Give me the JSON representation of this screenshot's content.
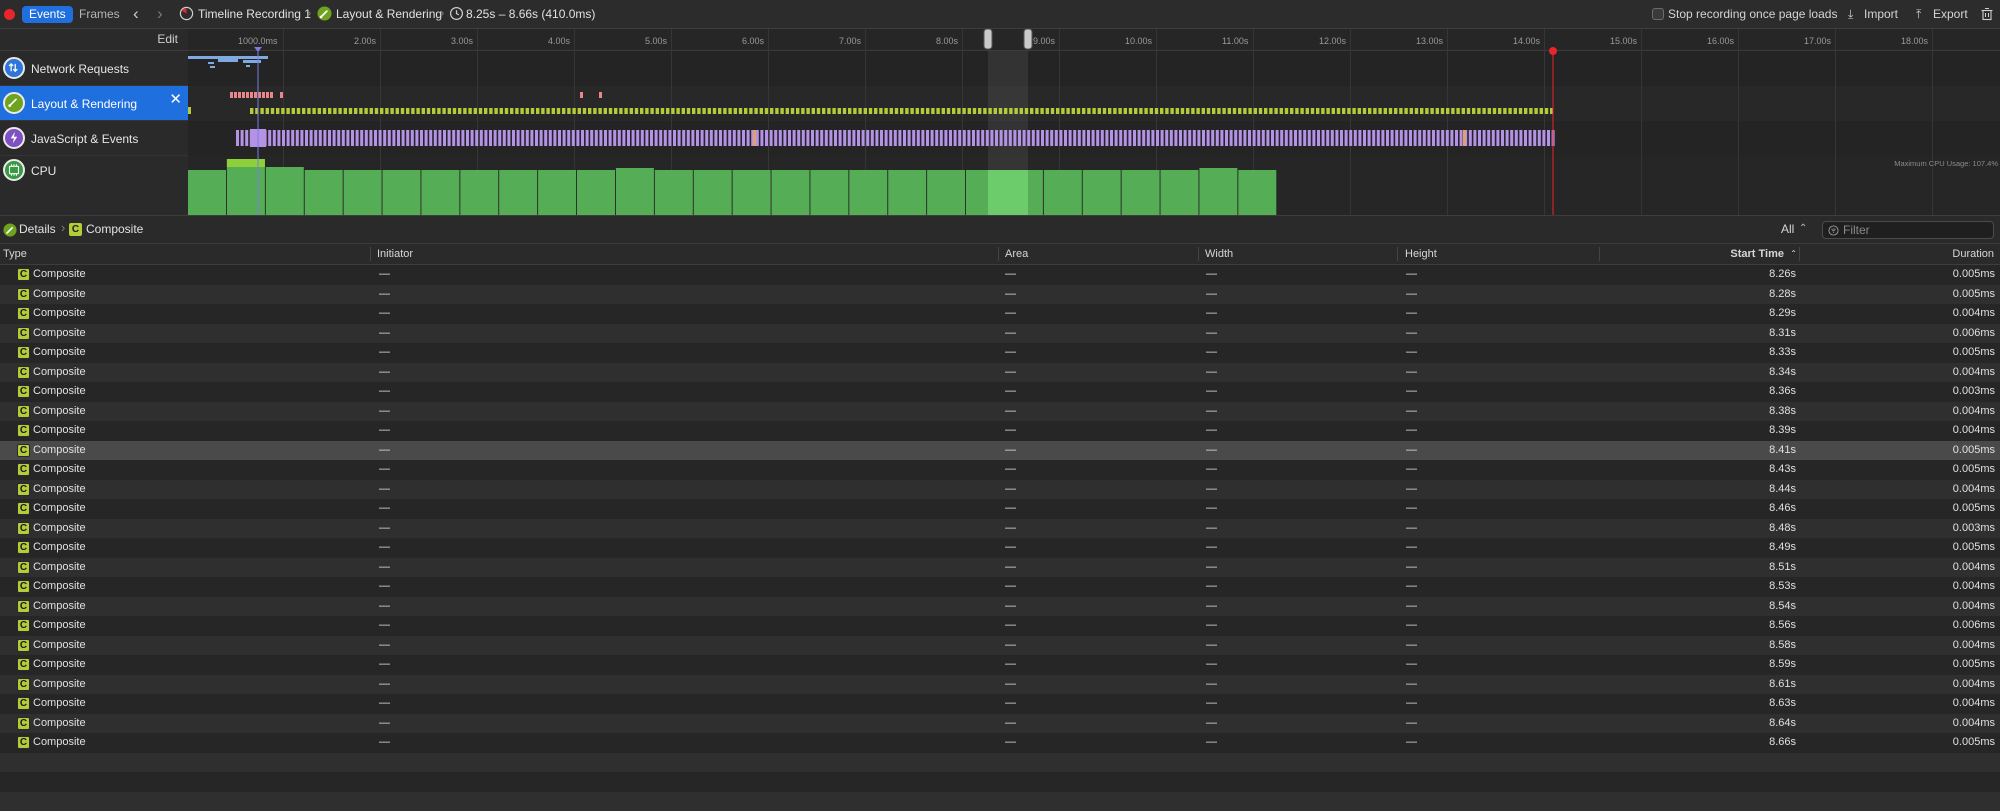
{
  "toolbar": {
    "tabs": [
      "Events",
      "Frames"
    ],
    "breadcrumb": [
      "Timeline Recording 1",
      "Layout & Rendering",
      "8.25s – 8.66s (410.0ms)"
    ],
    "stop_recording_label": "Stop recording once page loads",
    "import_label": "Import",
    "export_label": "Export",
    "colors": {
      "accent": "#1f6fde",
      "record": "#e8242c"
    }
  },
  "tracks": {
    "edit_label": "Edit",
    "ruler_ticks": [
      "1000.0ms",
      "2.00s",
      "3.00s",
      "4.00s",
      "5.00s",
      "6.00s",
      "7.00s",
      "8.00s",
      "9.00s",
      "10.00s",
      "11.00s",
      "12.00s",
      "13.00s",
      "14.00s",
      "15.00s",
      "16.00s",
      "17.00s",
      "18.00s"
    ],
    "items": [
      {
        "label": "Network Requests",
        "icon": "network-arrows-icon",
        "color": "#2f76d8"
      },
      {
        "label": "Layout & Rendering",
        "icon": "paintbrush-icon",
        "color": "#6fa31f"
      },
      {
        "label": "JavaScript & Events",
        "icon": "js-events-icon",
        "color": "#7f4fc4"
      },
      {
        "label": "CPU",
        "icon": "cpu-icon",
        "color": "#3a9a43"
      }
    ],
    "cpu_note": "Maximum CPU Usage: 107.4%",
    "colors": {
      "layout": "#b5cb3a",
      "js": "#b493e6",
      "cpu": "#55ad55",
      "paint": "#e9868a"
    }
  },
  "details": {
    "breadcrumb": [
      "Details",
      "Composite"
    ],
    "scope_label": "All",
    "filter_placeholder": "Filter"
  },
  "table": {
    "columns": [
      "Type",
      "Initiator",
      "Area",
      "Width",
      "Height",
      "Start Time",
      "Duration"
    ],
    "rows": [
      {
        "type": "Composite",
        "initiator": "—",
        "area": "—",
        "width": "—",
        "height": "—",
        "start": "8.26s",
        "duration": "0.005ms"
      },
      {
        "type": "Composite",
        "initiator": "—",
        "area": "—",
        "width": "—",
        "height": "—",
        "start": "8.28s",
        "duration": "0.005ms"
      },
      {
        "type": "Composite",
        "initiator": "—",
        "area": "—",
        "width": "—",
        "height": "—",
        "start": "8.29s",
        "duration": "0.004ms"
      },
      {
        "type": "Composite",
        "initiator": "—",
        "area": "—",
        "width": "—",
        "height": "—",
        "start": "8.31s",
        "duration": "0.006ms"
      },
      {
        "type": "Composite",
        "initiator": "—",
        "area": "—",
        "width": "—",
        "height": "—",
        "start": "8.33s",
        "duration": "0.005ms"
      },
      {
        "type": "Composite",
        "initiator": "—",
        "area": "—",
        "width": "—",
        "height": "—",
        "start": "8.34s",
        "duration": "0.004ms"
      },
      {
        "type": "Composite",
        "initiator": "—",
        "area": "—",
        "width": "—",
        "height": "—",
        "start": "8.36s",
        "duration": "0.003ms"
      },
      {
        "type": "Composite",
        "initiator": "—",
        "area": "—",
        "width": "—",
        "height": "—",
        "start": "8.38s",
        "duration": "0.004ms"
      },
      {
        "type": "Composite",
        "initiator": "—",
        "area": "—",
        "width": "—",
        "height": "—",
        "start": "8.39s",
        "duration": "0.004ms"
      },
      {
        "type": "Composite",
        "initiator": "—",
        "area": "—",
        "width": "—",
        "height": "—",
        "start": "8.41s",
        "duration": "0.005ms"
      },
      {
        "type": "Composite",
        "initiator": "—",
        "area": "—",
        "width": "—",
        "height": "—",
        "start": "8.43s",
        "duration": "0.005ms"
      },
      {
        "type": "Composite",
        "initiator": "—",
        "area": "—",
        "width": "—",
        "height": "—",
        "start": "8.44s",
        "duration": "0.004ms"
      },
      {
        "type": "Composite",
        "initiator": "—",
        "area": "—",
        "width": "—",
        "height": "—",
        "start": "8.46s",
        "duration": "0.005ms"
      },
      {
        "type": "Composite",
        "initiator": "—",
        "area": "—",
        "width": "—",
        "height": "—",
        "start": "8.48s",
        "duration": "0.003ms"
      },
      {
        "type": "Composite",
        "initiator": "—",
        "area": "—",
        "width": "—",
        "height": "—",
        "start": "8.49s",
        "duration": "0.005ms"
      },
      {
        "type": "Composite",
        "initiator": "—",
        "area": "—",
        "width": "—",
        "height": "—",
        "start": "8.51s",
        "duration": "0.004ms"
      },
      {
        "type": "Composite",
        "initiator": "—",
        "area": "—",
        "width": "—",
        "height": "—",
        "start": "8.53s",
        "duration": "0.004ms"
      },
      {
        "type": "Composite",
        "initiator": "—",
        "area": "—",
        "width": "—",
        "height": "—",
        "start": "8.54s",
        "duration": "0.004ms"
      },
      {
        "type": "Composite",
        "initiator": "—",
        "area": "—",
        "width": "—",
        "height": "—",
        "start": "8.56s",
        "duration": "0.006ms"
      },
      {
        "type": "Composite",
        "initiator": "—",
        "area": "—",
        "width": "—",
        "height": "—",
        "start": "8.58s",
        "duration": "0.004ms"
      },
      {
        "type": "Composite",
        "initiator": "—",
        "area": "—",
        "width": "—",
        "height": "—",
        "start": "8.59s",
        "duration": "0.005ms"
      },
      {
        "type": "Composite",
        "initiator": "—",
        "area": "—",
        "width": "—",
        "height": "—",
        "start": "8.61s",
        "duration": "0.004ms"
      },
      {
        "type": "Composite",
        "initiator": "—",
        "area": "—",
        "width": "—",
        "height": "—",
        "start": "8.63s",
        "duration": "0.004ms"
      },
      {
        "type": "Composite",
        "initiator": "—",
        "area": "—",
        "width": "—",
        "height": "—",
        "start": "8.64s",
        "duration": "0.004ms"
      },
      {
        "type": "Composite",
        "initiator": "—",
        "area": "—",
        "width": "—",
        "height": "—",
        "start": "8.66s",
        "duration": "0.005ms"
      }
    ],
    "selected_row_index": 9
  }
}
